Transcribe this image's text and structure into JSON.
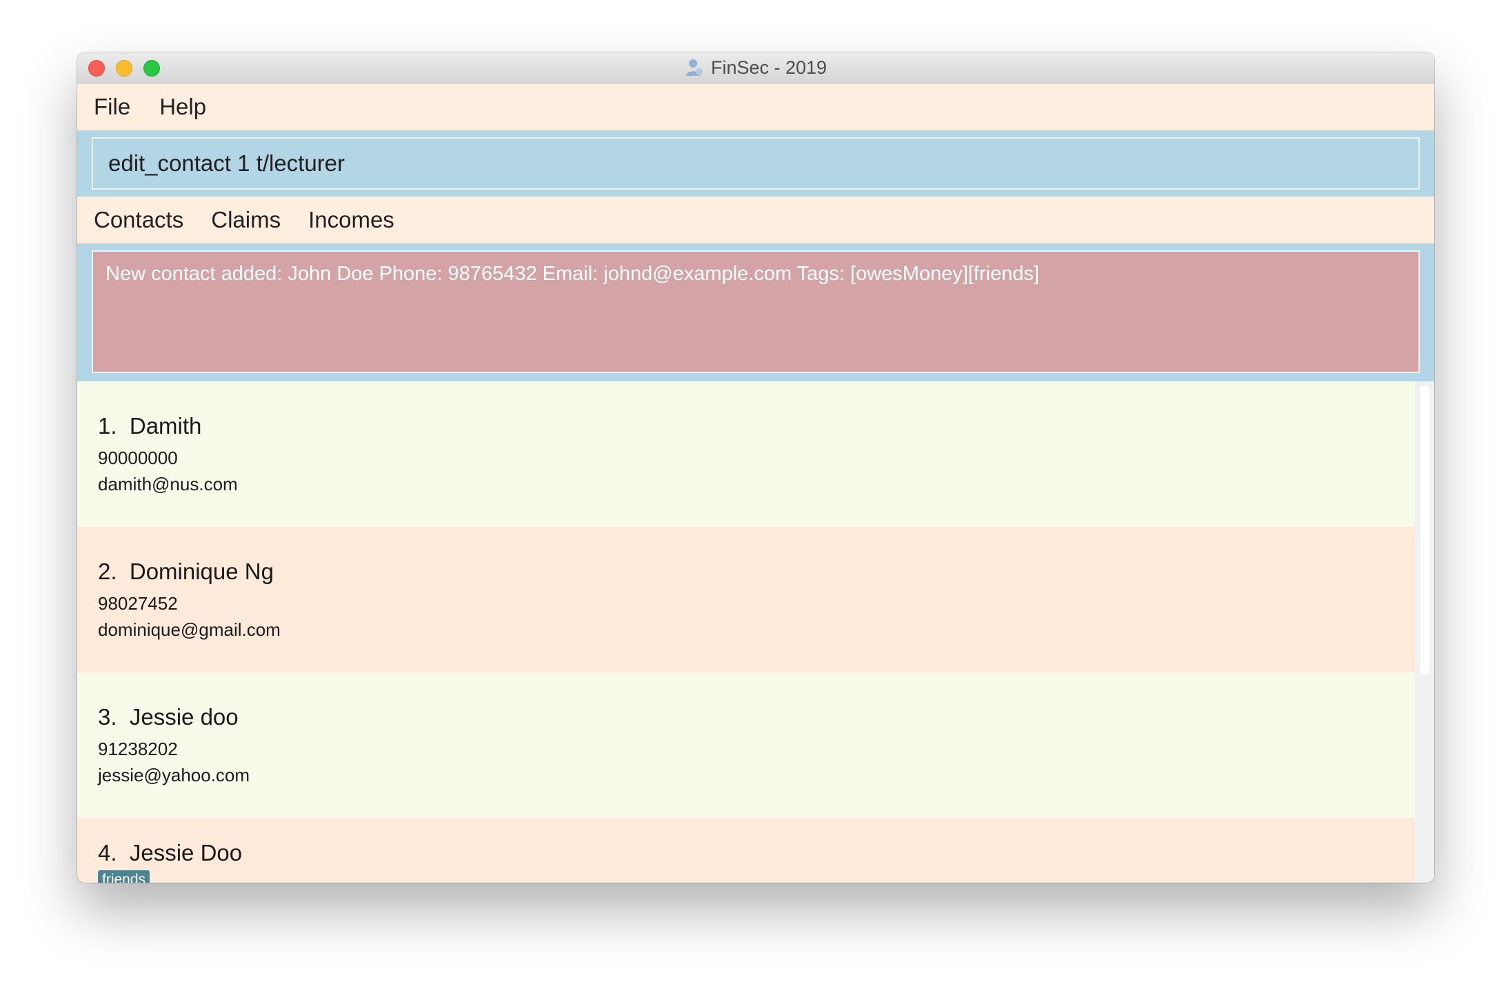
{
  "window": {
    "title": "FinSec - 2019",
    "title_icon": "person-icon"
  },
  "menu": {
    "items": [
      {
        "label": "File"
      },
      {
        "label": "Help"
      }
    ]
  },
  "command": {
    "value": "edit_contact 1 t/lecturer"
  },
  "tabs": [
    {
      "label": "Contacts"
    },
    {
      "label": "Claims"
    },
    {
      "label": "Incomes"
    }
  ],
  "result": {
    "text": "New contact added: John Doe Phone: 98765432 Email: johnd@example.com Tags: [owesMoney][friends]"
  },
  "contacts": [
    {
      "name": "1.  Damith",
      "phone": "90000000",
      "email": "damith@nus.com"
    },
    {
      "name": "2.  Dominique Ng",
      "phone": "98027452",
      "email": "dominique@gmail.com"
    },
    {
      "name": "3.  Jessie doo",
      "phone": "91238202",
      "email": "jessie@yahoo.com"
    },
    {
      "name": "4.  Jessie Doo",
      "tag": "friends"
    }
  ],
  "colors": {
    "panel_blue": "#b3d6e6",
    "result_bg": "#d3a3a5",
    "card_green": "#f7fbe9",
    "card_peach": "#fdeada",
    "tag_bg": "#4b8490"
  }
}
